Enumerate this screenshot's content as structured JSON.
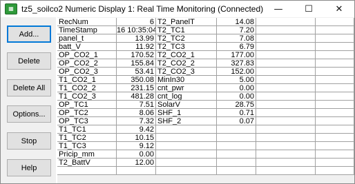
{
  "window": {
    "title": "tz5_soilco2 Numeric Display 1: Real Time Monitoring (Connected)",
    "icon_glyph": "▦",
    "minimize_glyph": "—",
    "maximize_glyph": "☐",
    "close_glyph": "✕"
  },
  "buttons": {
    "add": "Add...",
    "delete": "Delete",
    "delete_all": "Delete All",
    "options": "Options...",
    "stop": "Stop",
    "help": "Help"
  },
  "table": {
    "col1": [
      {
        "label": "RecNum",
        "value": "6"
      },
      {
        "label": "TimeStamp",
        "value": "16 10:35:04"
      },
      {
        "label": "panel_t",
        "value": "13.99"
      },
      {
        "label": "batt_V",
        "value": "11.92"
      },
      {
        "label": "OP_CO2_1",
        "value": "170.52"
      },
      {
        "label": "OP_CO2_2",
        "value": "155.84"
      },
      {
        "label": "OP_CO2_3",
        "value": "53.41"
      },
      {
        "label": "T1_CO2_1",
        "value": "350.08"
      },
      {
        "label": "T1_CO2_2",
        "value": "231.15"
      },
      {
        "label": "T1_CO2_3",
        "value": "481.28"
      },
      {
        "label": "OP_TC1",
        "value": "7.51"
      },
      {
        "label": "OP_TC2",
        "value": "8.06"
      },
      {
        "label": "OP_TC3",
        "value": "7.32"
      },
      {
        "label": "T1_TC1",
        "value": "9.42"
      },
      {
        "label": "T1_TC2",
        "value": "10.15"
      },
      {
        "label": "T1_TC3",
        "value": "9.12"
      },
      {
        "label": "Pricip_mm",
        "value": "0.00"
      },
      {
        "label": "T2_BattV",
        "value": "12.00"
      }
    ],
    "col2": [
      {
        "label": "T2_PanelT",
        "value": "14.08"
      },
      {
        "label": "T2_TC1",
        "value": "7.20"
      },
      {
        "label": "T2_TC2",
        "value": "7.08"
      },
      {
        "label": "T2_TC3",
        "value": "6.79"
      },
      {
        "label": "T2_CO2_1",
        "value": "177.00"
      },
      {
        "label": "T2_CO2_2",
        "value": "327.83"
      },
      {
        "label": "T2_CO2_3",
        "value": "152.00"
      },
      {
        "label": "MinIn30",
        "value": "5.00"
      },
      {
        "label": "cnt_pwr",
        "value": "0.00"
      },
      {
        "label": "cnt_log",
        "value": "0.00"
      },
      {
        "label": "SolarV",
        "value": "28.75"
      },
      {
        "label": "SHF_1",
        "value": "0.71"
      },
      {
        "label": "SHF_2",
        "value": "0.07"
      }
    ]
  }
}
